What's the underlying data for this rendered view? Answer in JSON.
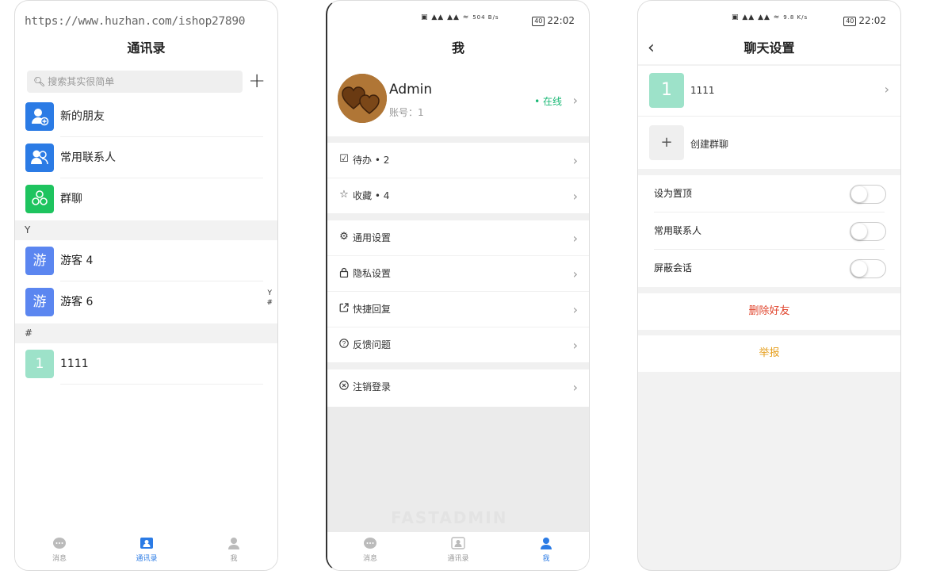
{
  "colors": {
    "accent": "#2b7be5",
    "online": "#19b875",
    "danger": "#e0432b",
    "warning": "#e6a020",
    "guest_avatar": "#5b86f0",
    "member_avatar": "#9de2c9",
    "green_group": "#1ec45f"
  },
  "status": {
    "time": "22:02",
    "battery": "40",
    "net_speed_1": "504 B/s",
    "net_speed_2": "9.8 K/s"
  },
  "watermark": {
    "url": "https://www.huzhan.com/ishop27890",
    "brand": "FASTADMIN"
  },
  "contacts": {
    "title": "通讯录",
    "search_placeholder": "搜索其实很简单",
    "add_icon": "plus-icon",
    "top_items": [
      {
        "label": "新的朋友",
        "icon": "user-add-icon"
      },
      {
        "label": "常用联系人",
        "icon": "contacts-icon"
      },
      {
        "label": "群聊",
        "icon": "group-icon"
      }
    ],
    "sections": [
      {
        "letter": "Y",
        "items": [
          {
            "avatar": "游",
            "name": "游客 4"
          },
          {
            "avatar": "游",
            "name": "游客 6"
          }
        ]
      },
      {
        "letter": "#",
        "items": [
          {
            "avatar": "1",
            "name": "1111"
          }
        ]
      }
    ],
    "index": [
      "Y",
      "#"
    ]
  },
  "tabs": [
    {
      "label": "消息",
      "icon": "chat-icon"
    },
    {
      "label": "通讯录",
      "icon": "contacts-book-icon"
    },
    {
      "label": "我",
      "icon": "person-icon"
    }
  ],
  "me": {
    "title": "我",
    "name": "Admin",
    "account": "账号：1",
    "status": "• 在线",
    "menu_group1": [
      {
        "label": "待办 • 2",
        "icon": "checkbox-icon"
      },
      {
        "label": "收藏 • 4",
        "icon": "star-icon"
      }
    ],
    "menu_group2": [
      {
        "label": "通用设置",
        "icon": "gear-icon"
      },
      {
        "label": "隐私设置",
        "icon": "lock-icon"
      },
      {
        "label": "快捷回复",
        "icon": "share-icon"
      },
      {
        "label": "反馈问题",
        "icon": "question-icon"
      }
    ],
    "menu_group3": [
      {
        "label": "注销登录",
        "icon": "logout-icon"
      }
    ]
  },
  "chat_settings": {
    "title": "聊天设置",
    "member_avatar": "1",
    "member_name": "1111",
    "create_group": "创建群聊",
    "switches": [
      {
        "label": "设为置顶",
        "on": false
      },
      {
        "label": "常用联系人",
        "on": false
      },
      {
        "label": "屏蔽会话",
        "on": false
      }
    ],
    "delete_friend": "删除好友",
    "report": "举报"
  }
}
